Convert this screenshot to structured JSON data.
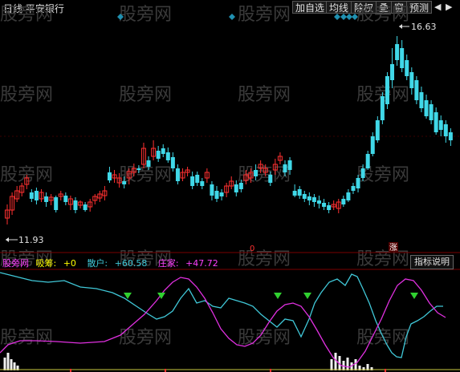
{
  "header": {
    "period": "日线",
    "stock_name": "平安银行",
    "buttons": [
      "加自选",
      "均线",
      "除权",
      "叠",
      "窗",
      "预测"
    ],
    "nav_prev": "◀",
    "nav_next": "▶"
  },
  "main_chart": {
    "high_label": "16.63",
    "low_label": "11.93",
    "marker_left": "0",
    "marker_right": "涨"
  },
  "indicator": {
    "name": "股旁网",
    "items": [
      {
        "label": "吸筹:",
        "value": "+0",
        "color": "#ffff00"
      },
      {
        "label": "散户:",
        "value": "+60.58",
        "color": "#40c8d8"
      },
      {
        "label": "庄家:",
        "value": "+47.72",
        "color": "#ff40ff"
      }
    ],
    "explain_button": "指标说明"
  },
  "watermark": "股旁网",
  "colors": {
    "up": "#ff3030",
    "down": "#40d8e8",
    "cyan_line": "#40c8d8",
    "magenta_line": "#e030e0",
    "signal": "#30d030",
    "marker": "#2090b0"
  }
}
